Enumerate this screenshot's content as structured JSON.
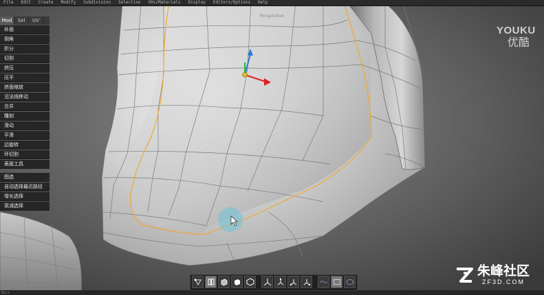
{
  "menubar": {
    "items": [
      "File",
      "Edit",
      "Create",
      "Modify",
      "Subdivision",
      "Selection",
      "UVs/Materials",
      "Display",
      "Editors/Options",
      "Help"
    ]
  },
  "viewport": {
    "view_label": "Perspective"
  },
  "panel": {
    "tabs": [
      "Mod",
      "Sel",
      "UV"
    ],
    "active_tab": "Mod",
    "tools": [
      "补面",
      "倒角",
      "折分",
      "切割",
      "挤压",
      "压平",
      "挤面缩放",
      "沿法线移动",
      "合并",
      "雕刻",
      "滑动",
      "平滑",
      "边旋转",
      "环切割",
      "表面工具"
    ],
    "selection": [
      "图选",
      "自动选择最近路径",
      "增长选择",
      "衰减选择"
    ]
  },
  "toolbar": {
    "buttons": [
      {
        "icon": "vertex-mode-icon",
        "active": false
      },
      {
        "icon": "edge-mode-icon",
        "active": true
      },
      {
        "icon": "face-mode-icon",
        "active": false
      },
      {
        "icon": "object-mode-icon",
        "active": false
      },
      {
        "icon": "cube-outline-icon",
        "active": false
      },
      {
        "icon": "axis-gizmo-icon",
        "active": false
      },
      {
        "icon": "move-tool-icon",
        "active": false
      },
      {
        "icon": "rotate-tool-icon",
        "active": false
      },
      {
        "icon": "scale-tool-icon",
        "active": false
      },
      {
        "icon": "lasso-icon",
        "active": false
      },
      {
        "icon": "rect-select-icon",
        "active": true
      },
      {
        "icon": "paint-select-icon",
        "active": false
      }
    ]
  },
  "watermarks": {
    "youku_en": "YOUKU",
    "youku_cn": "优酷",
    "zf3d_cn": "朱峰社区",
    "zf3d_en": "ZF3D.COM"
  },
  "status": {
    "text": "Ed:+"
  },
  "colors": {
    "panel_bg": "#262626",
    "tab_active": "#5a5a5a",
    "selection_edge": "#f0a830",
    "cursor_highlight": "#6fc3d6",
    "gizmo_x": "#e02020",
    "gizmo_y": "#2a7ad8",
    "gizmo_z": "#2ab830"
  }
}
